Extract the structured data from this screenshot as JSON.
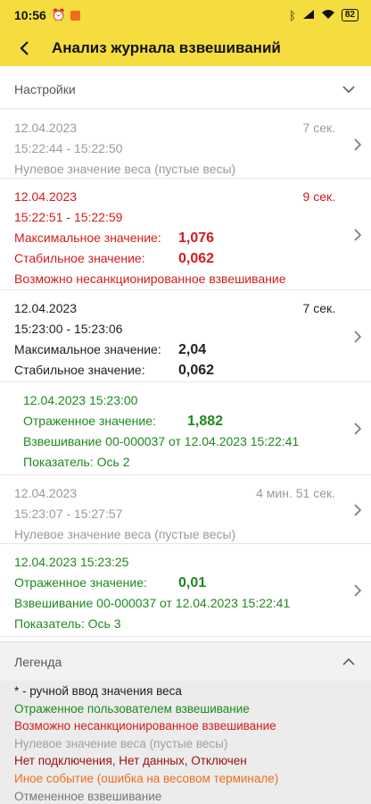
{
  "status_bar": {
    "time": "10:56",
    "battery": "82",
    "icons": [
      "alarm-icon",
      "app-notification-icon",
      "bluetooth-icon",
      "signal-icon",
      "wifi-icon",
      "battery-icon"
    ]
  },
  "app_bar": {
    "title": "Анализ журнала взвешиваний",
    "back_icon": "arrow-back-icon"
  },
  "settings": {
    "label": "Настройки"
  },
  "entries": [
    {
      "date": "12.04.2023",
      "time_range": "15:22:44 - 15:22:50",
      "duration": "7 сек.",
      "note": "Нулевое значение веса (пустые весы)"
    },
    {
      "date": "12.04.2023",
      "time_range": "15:22:51 - 15:22:59",
      "duration": "9 сек.",
      "max_label": "Максимальное значение:",
      "max_value": "1,076",
      "stable_label": "Стабильное значение:",
      "stable_value": "0,062",
      "note": "Возможно несанкционированное взвешивание"
    },
    {
      "date": "12.04.2023",
      "time_range": "15:23:00 - 15:23:06",
      "duration": "7 сек.",
      "max_label": "Максимальное значение:",
      "max_value": "2,04",
      "stable_label": "Стабильное значение:",
      "stable_value": "0,062"
    },
    {
      "datetime": "12.04.2023 15:23:00",
      "reflected_label": "Отраженное значение:",
      "reflected_value": "1,882",
      "weighing": "Взвешивание 00-000037 от 12.04.2023 15:22:41",
      "indicator": "Показатель: Ось 2"
    },
    {
      "date": "12.04.2023",
      "time_range": "15:23:07 - 15:27:57",
      "duration": "4 мин. 51 сек.",
      "note": "Нулевое значение веса (пустые весы)"
    },
    {
      "datetime": "12.04.2023 15:23:25",
      "reflected_label": "Отраженное значение:",
      "reflected_value": "0,01",
      "weighing": "Взвешивание 00-000037 от 12.04.2023 15:22:41",
      "indicator": "Показатель: Ось 3"
    }
  ],
  "legend": {
    "label": "Легенда",
    "items": [
      {
        "text": "* - ручной ввод значения веса",
        "color": "#222222"
      },
      {
        "text": "Отраженное пользователем взвешивание",
        "color": "#1e8a1e"
      },
      {
        "text": "Возможно несанкционированное взвешивание",
        "color": "#d31c1c"
      },
      {
        "text": "Нулевое значение веса (пустые весы)",
        "color": "#a0a0a0"
      },
      {
        "text": "Нет подключения, Нет данных, Отключен",
        "color": "#a01010"
      },
      {
        "text": "Иное событие (ошибка на весовом терминале)",
        "color": "#ef6c1a"
      },
      {
        "text": "Отмененное взвешивание",
        "color": "#777777"
      }
    ]
  }
}
